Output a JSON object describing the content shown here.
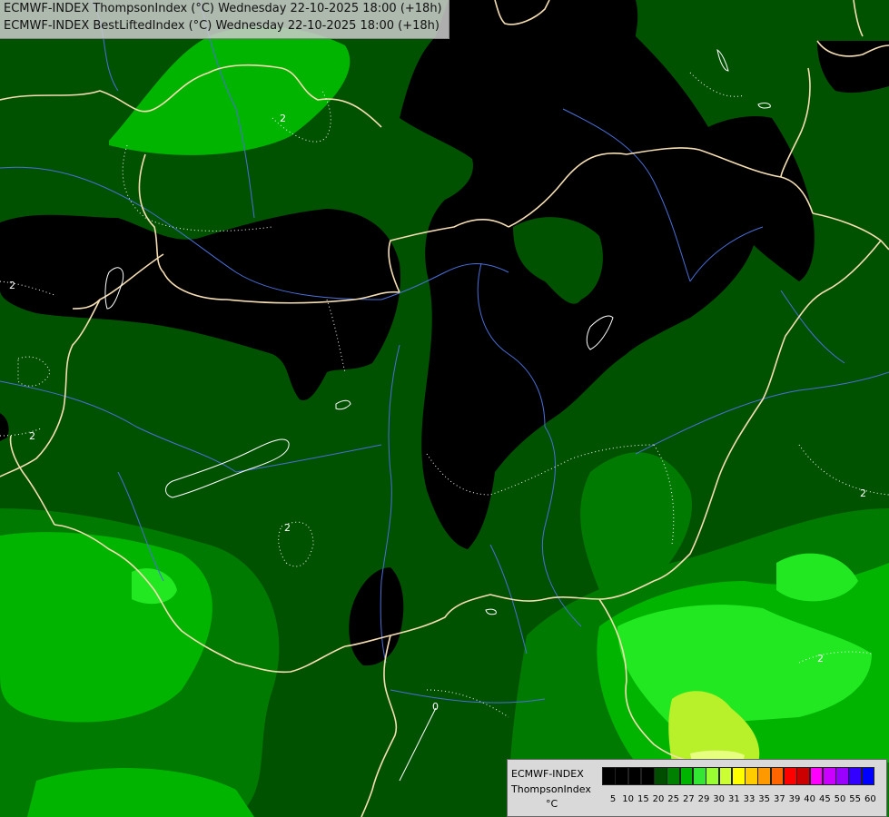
{
  "header": {
    "line1": "ECMWF-INDEX ThompsonIndex (°C) Wednesday 22-10-2025 18:00 (+18h)",
    "line2": "ECMWF-INDEX BestLiftedIndex (°C) Wednesday 22-10-2025 18:00 (+18h)"
  },
  "legend": {
    "title": "ECMWF-INDEX",
    "variable": "ThompsonIndex",
    "unit": "°C",
    "ticks": [
      "5",
      "10",
      "15",
      "20",
      "25",
      "27",
      "29",
      "30",
      "31",
      "33",
      "35",
      "37",
      "39",
      "40",
      "45",
      "50",
      "55",
      "60"
    ],
    "colors": [
      "#000000",
      "#000000",
      "#000000",
      "#000000",
      "#004d00",
      "#008000",
      "#00b300",
      "#33e633",
      "#99ff33",
      "#ccff33",
      "#ffff00",
      "#ffcc00",
      "#ff9900",
      "#ff6600",
      "#ff0000",
      "#cc0000",
      "#ff00ff",
      "#cc00ff",
      "#9900ff",
      "#3300ff",
      "#0000ff"
    ]
  },
  "contour_labels": [
    "2",
    "2",
    "2",
    "2",
    "2",
    "2",
    "0"
  ],
  "colors": {
    "dark_green": "#004d00",
    "mid_green": "#008000",
    "bright_green": "#00cc00",
    "lime": "#33ff33",
    "yellow_green": "#ccff00",
    "black": "#000000",
    "border": "#f5deb3",
    "river": "#4a6fd8"
  }
}
